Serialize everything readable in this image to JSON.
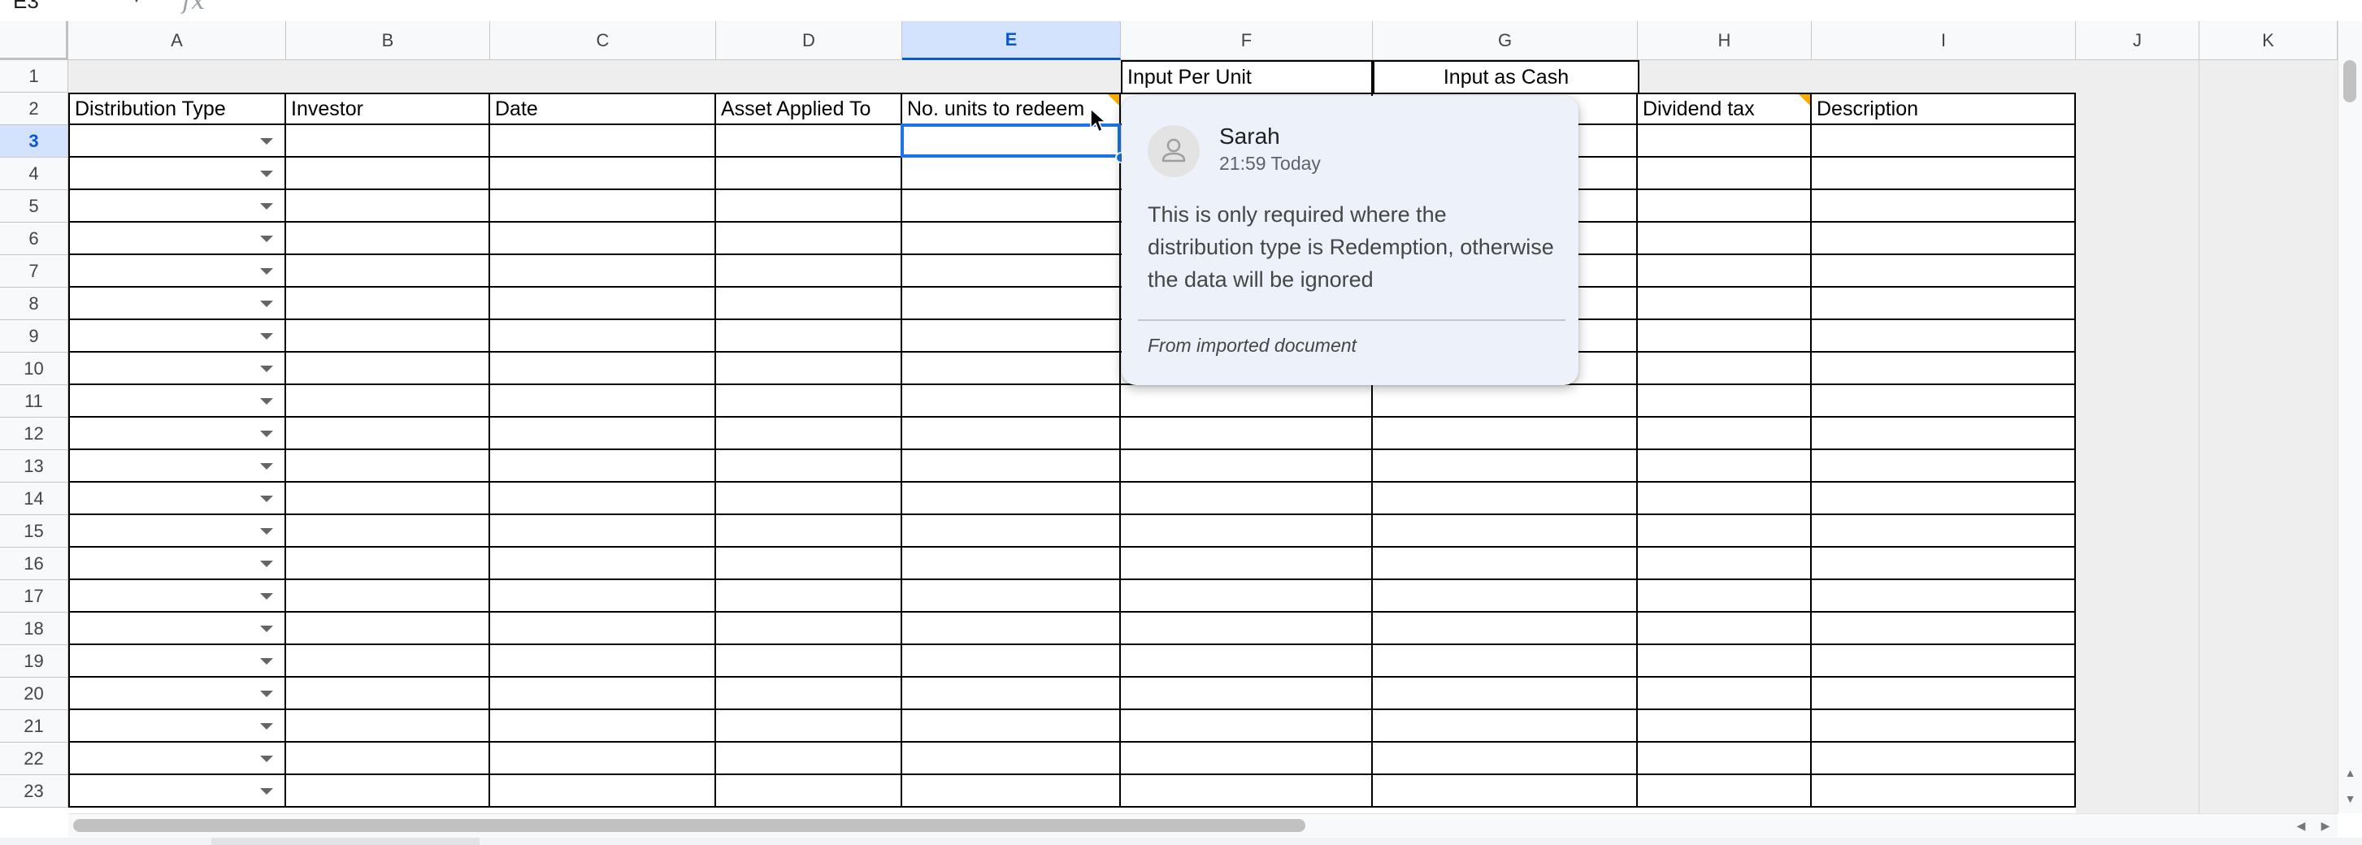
{
  "toolbar": {
    "name_box": "E3",
    "fx_symbol": "fx"
  },
  "sheet": {
    "columns": [
      "A",
      "B",
      "C",
      "D",
      "E",
      "F",
      "G",
      "H",
      "I",
      "J",
      "K"
    ],
    "rows": [
      "1",
      "2",
      "3",
      "4",
      "5",
      "6",
      "7",
      "8",
      "9",
      "10",
      "11",
      "12",
      "13",
      "14",
      "15",
      "16",
      "17",
      "18",
      "19",
      "20",
      "21",
      "22",
      "23"
    ],
    "selected_column": "E",
    "selected_row": "3",
    "row1_labels": {
      "F": "Input Per Unit",
      "G": "Input as Cash"
    },
    "headers": {
      "A": "Distribution Type",
      "B": "Investor",
      "C": "Date",
      "D": "Asset Applied To",
      "E": "No. units to redeem",
      "F": "",
      "G": "",
      "H": "Dividend tax",
      "I": "Description"
    },
    "comment_columns": [
      "E",
      "H"
    ],
    "dropdown_column": "A"
  },
  "comment": {
    "author": "Sarah",
    "time": "21:59 Today",
    "body": "This is only required where the distribution type is Redemption, otherwise the data will be ignored",
    "footer": "From imported document"
  },
  "colors": {
    "selection": "#1a73e8",
    "header_selected_bg": "#d3e3fd",
    "comment_marker": "#f9ab00",
    "card_bg": "#edf2fa"
  }
}
